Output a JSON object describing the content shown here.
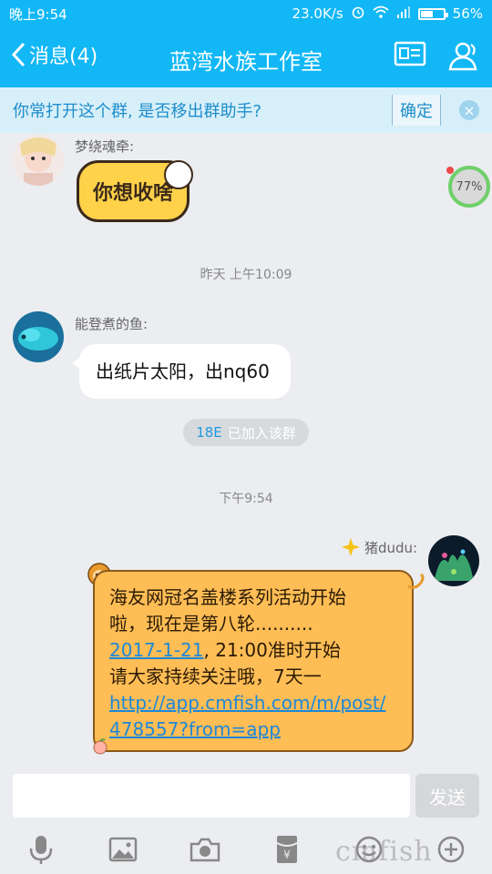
{
  "status": {
    "time": "晚上9:54",
    "speed": "23.0K/s",
    "battery": "56%",
    "battery_level": 0.56
  },
  "header": {
    "back_label": "消息(4)",
    "title": "蓝湾水族工作室"
  },
  "notice": {
    "text": "你常打开这个群, 是否移出群助手?",
    "confirm": "确定"
  },
  "messages": [
    {
      "sender": "梦绕魂牵:",
      "sticker_text": "你想收啥"
    },
    {
      "time": "昨天 上午10:09"
    },
    {
      "sender": "能登煮的鱼:",
      "text": "出纸片太阳，出nq60"
    },
    {
      "join_name": "18E",
      "join_text": "已加入该群"
    },
    {
      "time": "下午9:54"
    },
    {
      "sender": "猪dudu:",
      "lines": [
        "海友网冠名盖楼系列活动开始",
        "啦，现在是第八轮..........",
        ", 21:00准时开始",
        "请大家持续关注哦，7天一"
      ],
      "date_link": "2017-1-21",
      "url_line1": "http://app.cmfish.com/m/post/",
      "url_line2": "478557?from=app"
    }
  ],
  "floating_progress": "77%",
  "input": {
    "placeholder": "",
    "send": "发送"
  },
  "watermark": "cmfish"
}
